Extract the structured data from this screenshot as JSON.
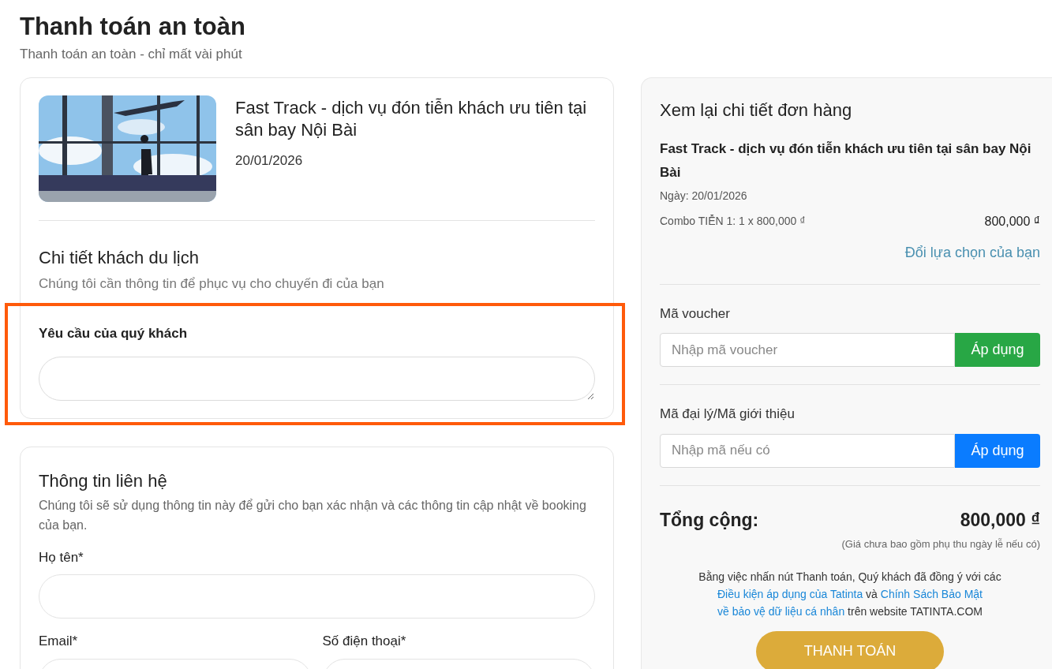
{
  "page": {
    "title": "Thanh toán an toàn",
    "subtitle": "Thanh toán an toàn - chỉ mất vài phút"
  },
  "product": {
    "title": "Fast Track - dịch vụ đón tiễn khách ưu tiên tại sân bay Nội Bài",
    "date": "20/01/2026"
  },
  "traveler_details": {
    "heading": "Chi tiết khách du lịch",
    "description": "Chúng tôi cần thông tin để phục vụ cho chuyến đi của bạn",
    "request_field": {
      "label": "Yêu cầu của quý khách",
      "highlighted": true
    }
  },
  "contact": {
    "heading": "Thông tin liên hệ",
    "description": "Chúng tôi sẽ sử dụng thông tin này để gửi cho bạn xác nhận và các thông tin cập nhật về booking của bạn.",
    "fields": [
      {
        "label": "Họ tên*"
      },
      {
        "label": "Email*"
      },
      {
        "label": "Số điện thoại*"
      }
    ]
  },
  "order_summary": {
    "heading": "Xem lại chi tiết đơn hàng",
    "product_title": "Fast Track - dịch vụ đón tiễn khách ưu tiên tại sân bay Nội Bài",
    "date": "Ngày: 20/01/2026",
    "line_description": "Combo TIỄN 1: 1 x 800,000 ₫",
    "line_amount": "800,000 ₫",
    "change_link": "Đổi lựa chọn của bạn",
    "codes": [
      {
        "label": "Mã voucher",
        "placeholder": "Nhập mã voucher",
        "button": "Áp dụng",
        "color": "#28a745"
      },
      {
        "label": "Mã đại lý/Mã giới thiệu",
        "placeholder": "Nhập mã nếu có",
        "button": "Áp dụng",
        "color": "#0a7cff"
      }
    ],
    "total_label": "Tổng cộng:",
    "total": "800,000 ₫",
    "note": "(Giá chưa bao gồm phụ thu ngày lễ nếu có)",
    "terms": [
      {
        "text": "Bằng việc nhấn nút Thanh toán, Quý khách đã đồng ý với các ",
        "kind": "text"
      },
      {
        "text": "Điều kiện áp dụng của Tatinta",
        "kind": "link"
      },
      {
        "text": " và ",
        "kind": "text"
      },
      {
        "text": "Chính Sách Bảo Mật ",
        "kind": "link"
      },
      {
        "text": "về bảo vệ dữ liệu cá nhân",
        "kind": "link"
      },
      {
        "text": " trên website TATINTA.COM",
        "kind": "text"
      }
    ],
    "pay_button": "THANH TOÁN"
  }
}
